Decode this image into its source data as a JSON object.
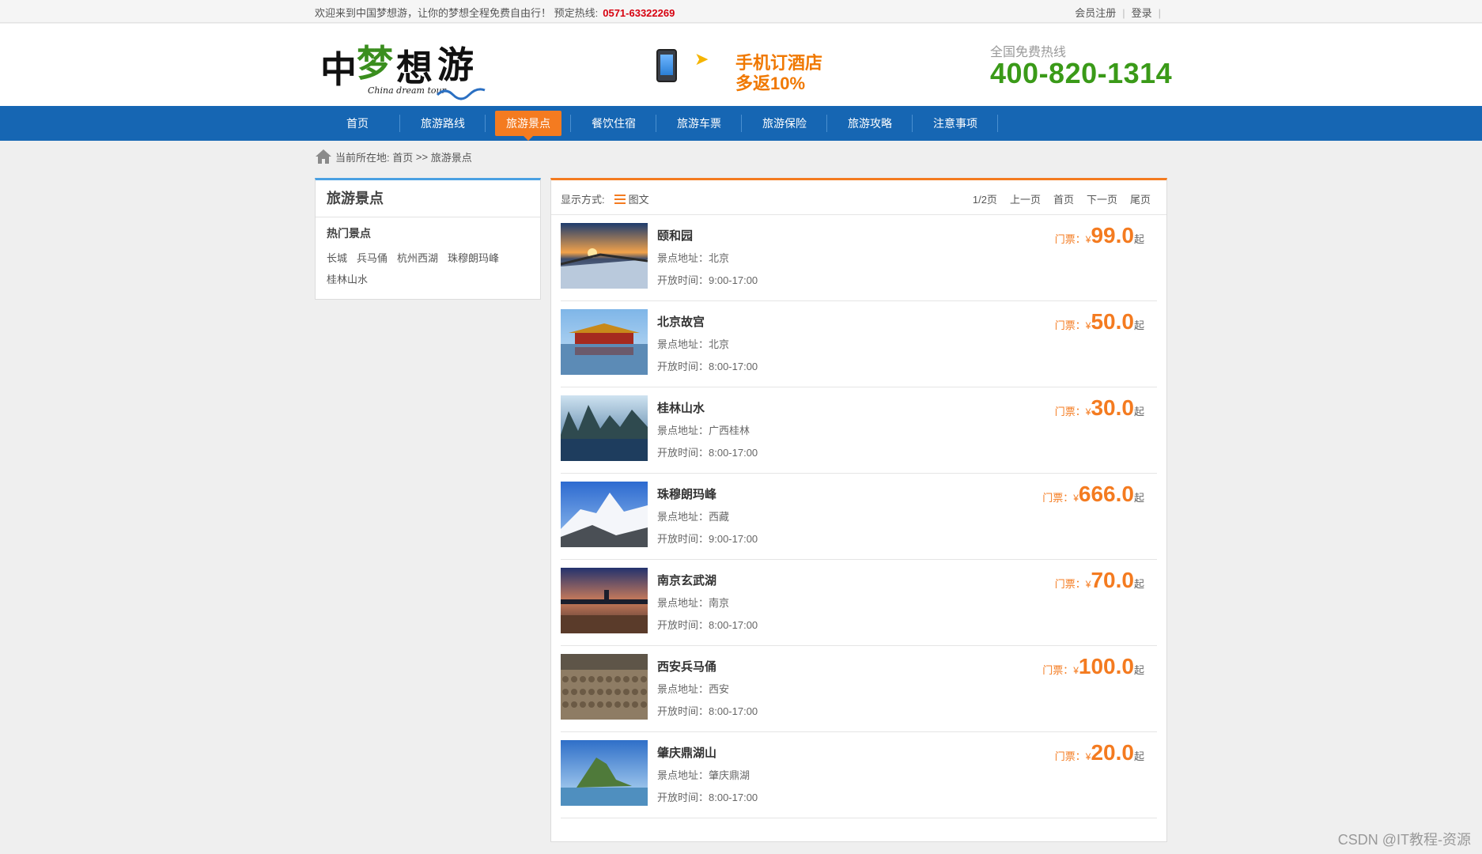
{
  "topbar": {
    "welcome": "欢迎来到中国梦想游，让你的梦想全程免费自由行！ 预定热线:",
    "hotline": "0571-63322269",
    "register": "会员注册",
    "login": "登录"
  },
  "header": {
    "promo_line1": "手机订酒店",
    "promo_line2": "多返10%",
    "hotline_label": "全国免费热线",
    "hotline_number": "400-820-1314"
  },
  "nav": {
    "items": [
      {
        "label": "首页"
      },
      {
        "label": "旅游路线"
      },
      {
        "label": "旅游景点"
      },
      {
        "label": "餐饮住宿"
      },
      {
        "label": "旅游车票"
      },
      {
        "label": "旅游保险"
      },
      {
        "label": "旅游攻略"
      },
      {
        "label": "注意事项"
      }
    ],
    "active_index": 2
  },
  "breadcrumb": {
    "prefix": "当前所在地:",
    "home": "首页",
    "sep": ">>",
    "current": "旅游景点"
  },
  "sidebar": {
    "title": "旅游景点",
    "subtitle": "热门景点",
    "tags": [
      "长城",
      "兵马俑",
      "杭州西湖",
      "珠穆朗玛峰",
      "桂林山水"
    ]
  },
  "toolbar": {
    "mode_label": "显示方式:",
    "mode_value": "图文",
    "page_info": "1/2页",
    "prev": "上一页",
    "first": "首页",
    "next": "下一页",
    "last": "尾页"
  },
  "spots": [
    {
      "name": "颐和园",
      "addr": "景点地址：北京",
      "hours": "开放时间：9:00-17:00",
      "price_label": "门票：",
      "yen": "¥",
      "price": "99.0",
      "qi": "起",
      "thumb": "sunset"
    },
    {
      "name": "北京故宫",
      "addr": "景点地址：北京",
      "hours": "开放时间：8:00-17:00",
      "price_label": "门票：",
      "yen": "¥",
      "price": "50.0",
      "qi": "起",
      "thumb": "palace"
    },
    {
      "name": "桂林山水",
      "addr": "景点地址：广西桂林",
      "hours": "开放时间：8:00-17:00",
      "price_label": "门票：",
      "yen": "¥",
      "price": "30.0",
      "qi": "起",
      "thumb": "karst"
    },
    {
      "name": "珠穆朗玛峰",
      "addr": "景点地址：西藏",
      "hours": "开放时间：9:00-17:00",
      "price_label": "门票：",
      "yen": "¥",
      "price": "666.0",
      "qi": "起",
      "thumb": "snow"
    },
    {
      "name": "南京玄武湖",
      "addr": "景点地址：南京",
      "hours": "开放时间：8:00-17:00",
      "price_label": "门票：",
      "yen": "¥",
      "price": "70.0",
      "qi": "起",
      "thumb": "dusk"
    },
    {
      "name": "西安兵马俑",
      "addr": "景点地址：西安",
      "hours": "开放时间：8:00-17:00",
      "price_label": "门票：",
      "yen": "¥",
      "price": "100.0",
      "qi": "起",
      "thumb": "terracotta"
    },
    {
      "name": "肇庆鼎湖山",
      "addr": "景点地址：肇庆鼎湖",
      "hours": "开放时间：8:00-17:00",
      "price_label": "门票：",
      "yen": "¥",
      "price": "20.0",
      "qi": "起",
      "thumb": "mountain"
    }
  ],
  "watermark": "CSDN @IT教程-资源",
  "colors": {
    "nav_bg": "#1666b3",
    "accent_orange": "#f47b20",
    "hotline_green": "#3a9a18",
    "sidebar_top": "#4aa1e2"
  }
}
